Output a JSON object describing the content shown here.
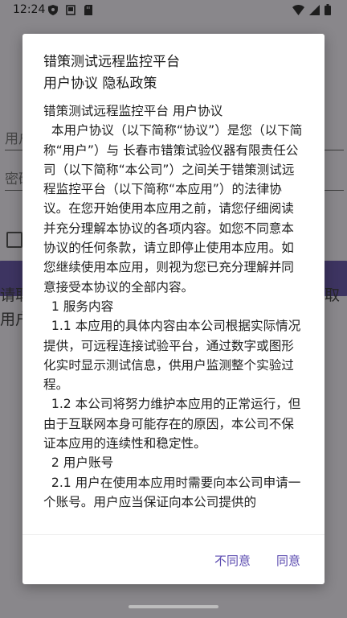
{
  "status_bar": {
    "time": "12:24"
  },
  "background": {
    "username_placeholder": "用户",
    "password_placeholder": "密码",
    "left_text_1": "请取",
    "left_text_2": "用户",
    "right_text": "取"
  },
  "dialog": {
    "title_line1": "错策测试远程监控平台",
    "title_line2": "用户协议 隐私政策",
    "paragraphs": [
      "错策测试远程监控平台 用户协议",
      "  本用户协议（以下简称“协议”）是您（以下简称“用户”）与 长春市错策试验仪器有限责任公司（以下简称“本公司”）之间关于错策测试远程监控平台（以下简称“本应用”）的法律协议。在您开始使用本应用之前，请您仔细阅读并充分理解本协议的各项内容。如您不同意本协议的任何条款，请立即停止使用本应用。如您继续使用本应用，则视为您已充分理解并同意接受本协议的全部内容。",
      "  1 服务内容",
      "  1.1 本应用的具体内容由本公司根据实际情况提供，可远程连接试验平台，通过数字或图形化实时显示测试信息，供用户监测整个实验过程。",
      "  1.2 本公司将努力维护本应用的正常运行，但由于互联网本身可能存在的原因，本公司不保证本应用的连续性和稳定性。",
      "  2 用户账号",
      "  2.1 用户在使用本应用时需要向本公司申请一个账号。用户应当保证向本公司提供的"
    ],
    "disagree_label": "不同意",
    "agree_label": "同意"
  }
}
